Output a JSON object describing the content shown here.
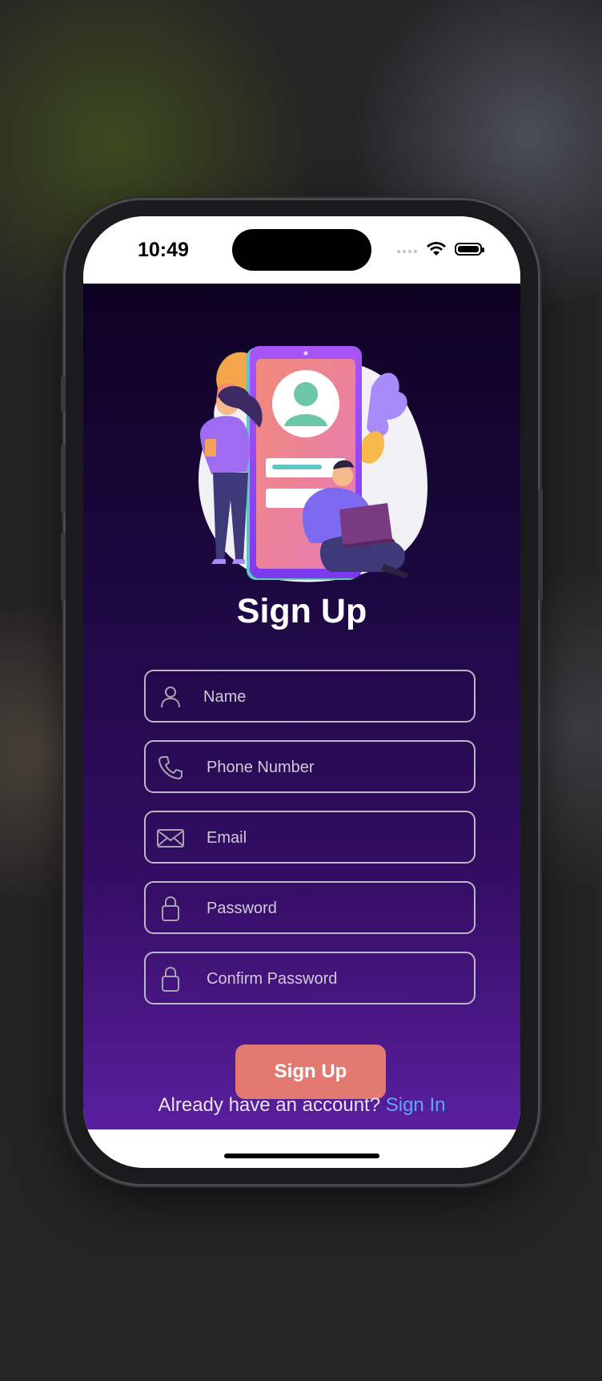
{
  "status_bar": {
    "time": "10:49"
  },
  "signup": {
    "title": "Sign Up",
    "fields": [
      {
        "placeholder": "Name",
        "icon": "person-icon"
      },
      {
        "placeholder": "Phone Number",
        "icon": "phone-icon"
      },
      {
        "placeholder": "Email",
        "icon": "envelope-icon"
      },
      {
        "placeholder": "Password",
        "icon": "lock-icon"
      },
      {
        "placeholder": "Confirm Password",
        "icon": "lock-icon"
      }
    ],
    "button_label": "Sign Up",
    "account_prompt": "Already have an account?",
    "signin_link": "Sign In"
  },
  "colors": {
    "button": "#e27a72",
    "link": "#5fa3ff",
    "gradient_top": "#0e0222",
    "gradient_bottom": "#5a1f9e",
    "field_border": "#bcb8c8"
  }
}
